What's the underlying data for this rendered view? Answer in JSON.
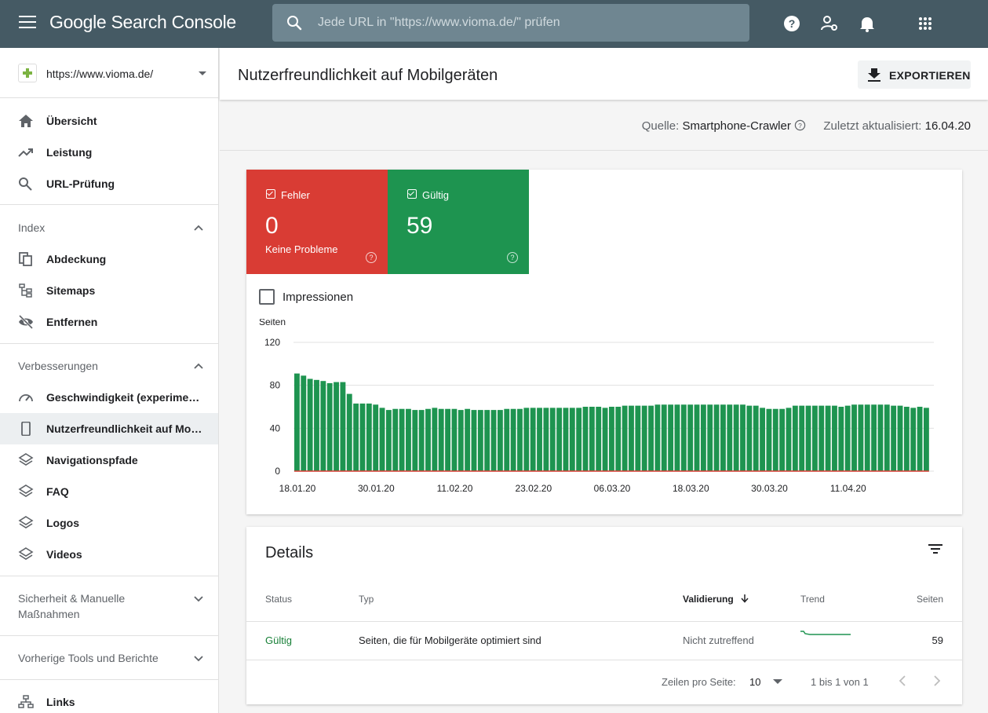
{
  "header": {
    "brand": "Google Search Console",
    "search_placeholder": "Jede URL in \"https://www.vioma.de/\" prüfen",
    "icons": [
      "menu-icon",
      "search-icon",
      "help-icon",
      "user-settings-icon",
      "bell-icon",
      "apps-grid-icon"
    ]
  },
  "sidebar": {
    "property": "https://www.vioma.de/",
    "top_items": [
      {
        "label": "Übersicht",
        "icon": "home-icon"
      },
      {
        "label": "Leistung",
        "icon": "trending-up-icon"
      },
      {
        "label": "URL-Prüfung",
        "icon": "search-icon"
      }
    ],
    "index_section": "Index",
    "index_items": [
      {
        "label": "Abdeckung",
        "icon": "copy-pages-icon"
      },
      {
        "label": "Sitemaps",
        "icon": "sitemap-icon"
      },
      {
        "label": "Entfernen",
        "icon": "eye-off-icon"
      }
    ],
    "improvements_section": "Verbesserungen",
    "improvements_items": [
      {
        "label": "Geschwindigkeit (experimentell)",
        "icon": "speedometer-icon"
      },
      {
        "label": "Nutzerfreundlichkeit auf Mobil…",
        "icon": "smartphone-icon"
      },
      {
        "label": "Navigationspfade",
        "icon": "layers-icon"
      },
      {
        "label": "FAQ",
        "icon": "layers-icon"
      },
      {
        "label": "Logos",
        "icon": "layers-icon"
      },
      {
        "label": "Videos",
        "icon": "layers-icon"
      }
    ],
    "security_section_line1": "Sicherheit & Manuelle",
    "security_section_line2": "Maßnahmen",
    "legacy_section": "Vorherige Tools und Berichte",
    "links_item": {
      "label": "Links",
      "icon": "links-icon"
    }
  },
  "main": {
    "page_title": "Nutzerfreundlichkeit auf Mobilgeräten",
    "export_label": "EXPORTIEREN",
    "source_label": "Quelle:",
    "source_value": "Smartphone-Crawler",
    "updated_label": "Zuletzt aktualisiert:",
    "updated_value": "16.04.20"
  },
  "tiles": {
    "error": {
      "label": "Fehler",
      "value": "0",
      "sub": "Keine Probleme",
      "color": "#d93c34"
    },
    "valid": {
      "label": "Gültig",
      "value": "59",
      "color": "#1e9450"
    }
  },
  "impressions_label": "Impressionen",
  "chart_data": {
    "type": "bar",
    "ylabel": "Seiten",
    "ylim": [
      0,
      120
    ],
    "yticks": [
      "120",
      "80",
      "40",
      "0"
    ],
    "x_tick_labels": [
      "18.01.20",
      "30.01.20",
      "11.02.20",
      "23.02.20",
      "06.03.20",
      "18.03.20",
      "30.03.20",
      "11.04.20"
    ],
    "bar_color": "#1e9450",
    "baseline_color": "#d93c34",
    "grid": true,
    "values": [
      91,
      89,
      86,
      85,
      84,
      82,
      83,
      83,
      72,
      63,
      63,
      63,
      62,
      59,
      57,
      58,
      58,
      58,
      57,
      57,
      58,
      59,
      58,
      58,
      58,
      57,
      58,
      57,
      57,
      57,
      57,
      57,
      58,
      58,
      58,
      59,
      59,
      59,
      59,
      59,
      59,
      59,
      59,
      59,
      60,
      60,
      60,
      59,
      60,
      60,
      61,
      61,
      61,
      61,
      61,
      62,
      62,
      62,
      62,
      62,
      62,
      62,
      62,
      62,
      62,
      62,
      62,
      62,
      62,
      61,
      61,
      59,
      58,
      58,
      58,
      59,
      61,
      61,
      61,
      61,
      61,
      61,
      61,
      60,
      61,
      62,
      62,
      62,
      62,
      62,
      62,
      61,
      61,
      60,
      59,
      60,
      59
    ]
  },
  "details": {
    "title": "Details",
    "columns": [
      "Status",
      "Typ",
      "Validierung",
      "Trend",
      "Seiten"
    ],
    "rows": [
      {
        "status": "Gültig",
        "type": "Seiten, die für Mobilgeräte optimiert sind",
        "validation": "Nicht zutreffend",
        "pages": "59"
      }
    ],
    "status_color": "#188038",
    "rows_per_page_label": "Zeilen pro Seite:",
    "rows_per_page_value": "10",
    "range_label": "1 bis 1 von 1"
  }
}
